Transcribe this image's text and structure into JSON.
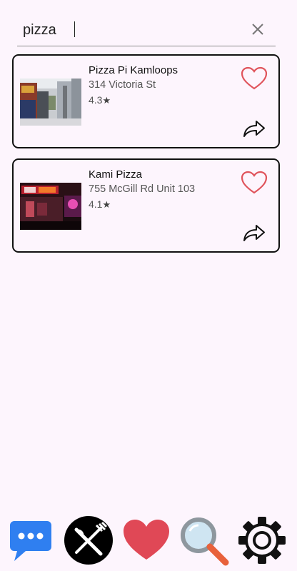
{
  "search": {
    "value": "pizza",
    "clear_icon": "close-icon"
  },
  "results": [
    {
      "name": "Pizza Pi Kamloops",
      "address": "314 Victoria St",
      "rating": "4.3",
      "rating_icon": "star-icon",
      "favorite_icon": "heart-outline-icon",
      "share_icon": "share-arrow-icon"
    },
    {
      "name": "Kami Pizza",
      "address": "755 McGill Rd Unit 103",
      "rating": "4.1",
      "rating_icon": "star-icon",
      "favorite_icon": "heart-outline-icon",
      "share_icon": "share-arrow-icon"
    }
  ],
  "bottom_nav": [
    {
      "icon": "chat-bubble-icon",
      "color": "#2f7ff0"
    },
    {
      "icon": "fork-knife-icon",
      "color": "#000000"
    },
    {
      "icon": "heart-icon",
      "color": "#e04856"
    },
    {
      "icon": "magnifier-icon",
      "color": "#e8613b"
    },
    {
      "icon": "gear-icon",
      "color": "#111111"
    }
  ],
  "colors": {
    "background": "#fdf5fd",
    "favorite": "#e0545c",
    "card_border": "#111111"
  }
}
